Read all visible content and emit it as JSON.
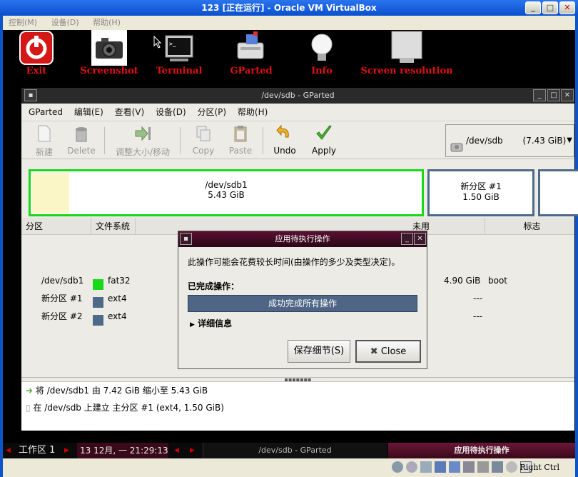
{
  "vbox": {
    "title": "123 [正在运行] - Oracle VM VirtualBox",
    "menu": [
      "控制(M)",
      "设备(D)",
      "帮助(H)"
    ],
    "host_key": "Right Ctrl"
  },
  "launchers": [
    {
      "label": "Exit",
      "icon": "power-icon"
    },
    {
      "label": "Screenshot",
      "icon": "camera-icon"
    },
    {
      "label": "Terminal",
      "icon": "terminal-icon"
    },
    {
      "label": "GParted",
      "icon": "gparted-icon"
    },
    {
      "label": "Info",
      "icon": "lightbulb-icon"
    },
    {
      "label": "Screen resolution",
      "icon": "monitor-icon"
    }
  ],
  "gparted": {
    "title": "/dev/sdb - GParted",
    "menu": [
      "GParted",
      "编辑(E)",
      "查看(V)",
      "设备(D)",
      "分区(P)",
      "帮助(H)"
    ],
    "toolbar": {
      "new": "新建",
      "delete": "Delete",
      "resize": "调整大小/移动",
      "copy": "Copy",
      "paste": "Paste",
      "undo": "Undo",
      "apply": "Apply"
    },
    "device_selector": {
      "device": "/dev/sdb",
      "size": "(7.43 GiB)"
    },
    "graph": [
      {
        "name": "/dev/sdb1",
        "size": "5.43 GiB"
      },
      {
        "name": "新分区 #1",
        "size": "1.50 GiB"
      }
    ],
    "table": {
      "headers": [
        "分区",
        "文件系统",
        "未用",
        "标志"
      ],
      "rows": [
        {
          "partition": "/dev/sdb1",
          "fs": "fat32",
          "fs_color": "#18d818",
          "unused": "4.90 GiB",
          "flags": "boot"
        },
        {
          "partition": "新分区 #1",
          "fs": "ext4",
          "fs_color": "#4e6a88",
          "unused": "---",
          "flags": ""
        },
        {
          "partition": "新分区 #2",
          "fs": "ext4",
          "fs_color": "#4e6a88",
          "unused": "---",
          "flags": ""
        }
      ]
    },
    "pending_ops": [
      "将 /dev/sdb1 由 7.42 GiB 缩小至 5.43 GiB",
      "在 /dev/sdb 上建立 主分区 #1 (ext4, 1.50 GiB)"
    ]
  },
  "dialog": {
    "title": "应用待执行操作",
    "message": "此操作可能会花费较长时间(由操作的多少及类型决定)。",
    "completed_label": "已完成操作：",
    "progress_text": "成功完成所有操作",
    "progress": 1.0,
    "details_label": "详细信息",
    "save_button": "保存细节(S)",
    "close_button": "Close"
  },
  "taskbar": {
    "workspace": "工作区 1",
    "clock": "13 12月, 一 21:29:13",
    "window_1": "/dev/sdb - GParted",
    "window_2": "应用待执行操作"
  }
}
